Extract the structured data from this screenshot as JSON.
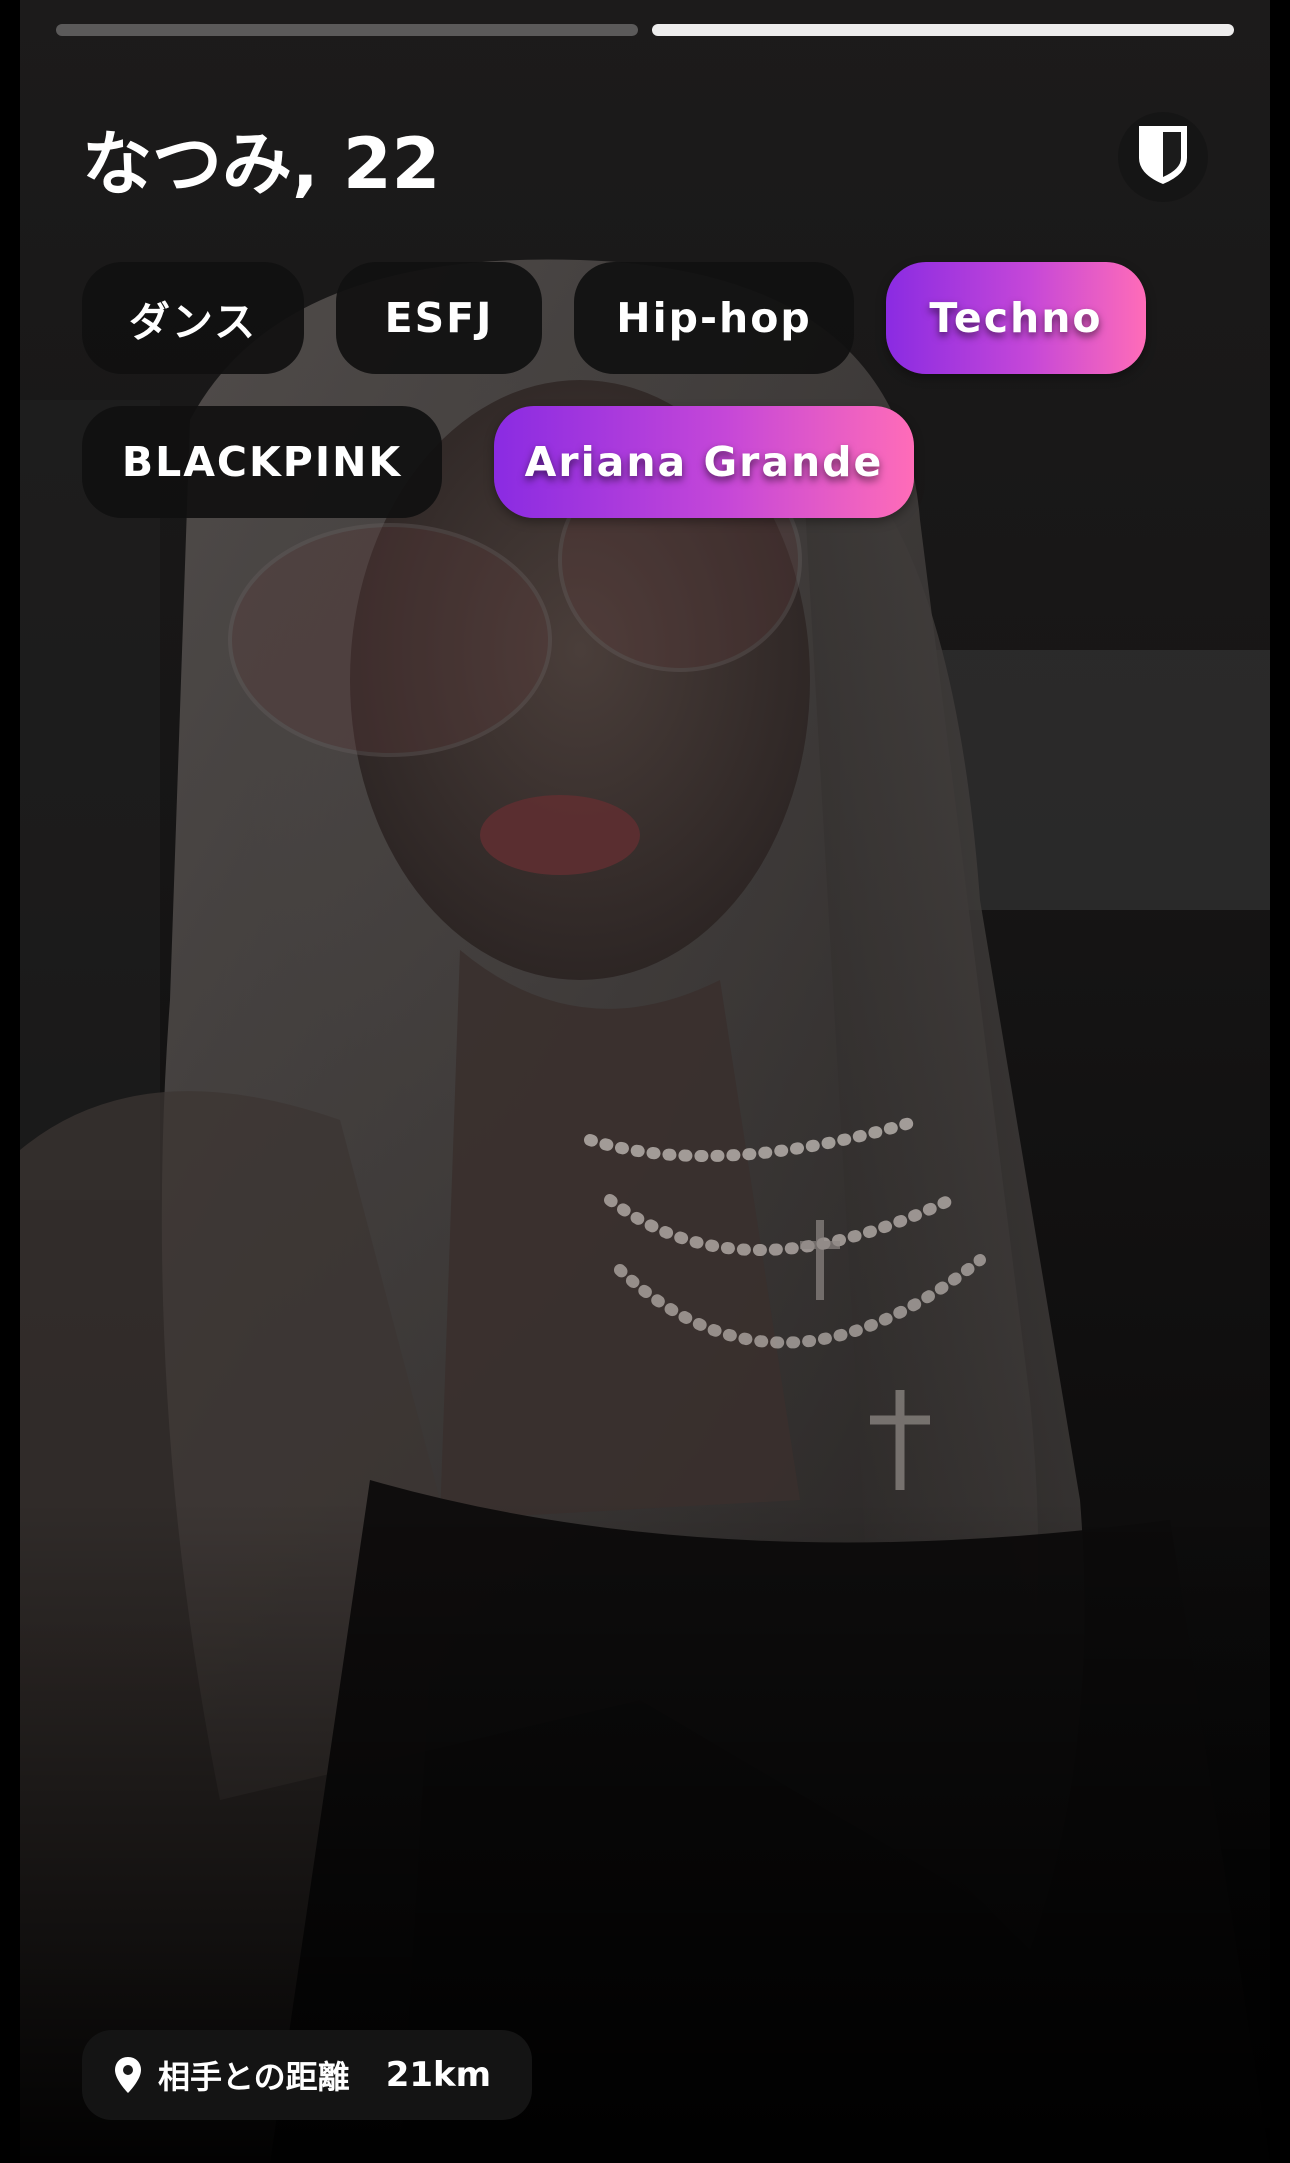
{
  "progress": {
    "segments": 2,
    "active_index": 1
  },
  "profile": {
    "title": "なつみ, 22"
  },
  "tags": [
    {
      "label": "ダンス",
      "highlight": false
    },
    {
      "label": "ESFJ",
      "highlight": false
    },
    {
      "label": "Hip-hop",
      "highlight": false
    },
    {
      "label": "Techno",
      "highlight": true
    },
    {
      "label": "BLACKPINK",
      "highlight": false
    },
    {
      "label": "Ariana Grande",
      "highlight": true
    }
  ],
  "distance": {
    "label": "相手との距離",
    "value": "21km"
  },
  "icons": {
    "safety": "shield-icon",
    "location": "location-pin-icon"
  },
  "colors": {
    "highlight_start": "#8a2be2",
    "highlight_end": "#ff6cb8",
    "chip_bg": "#101010",
    "text": "#ffffff"
  }
}
